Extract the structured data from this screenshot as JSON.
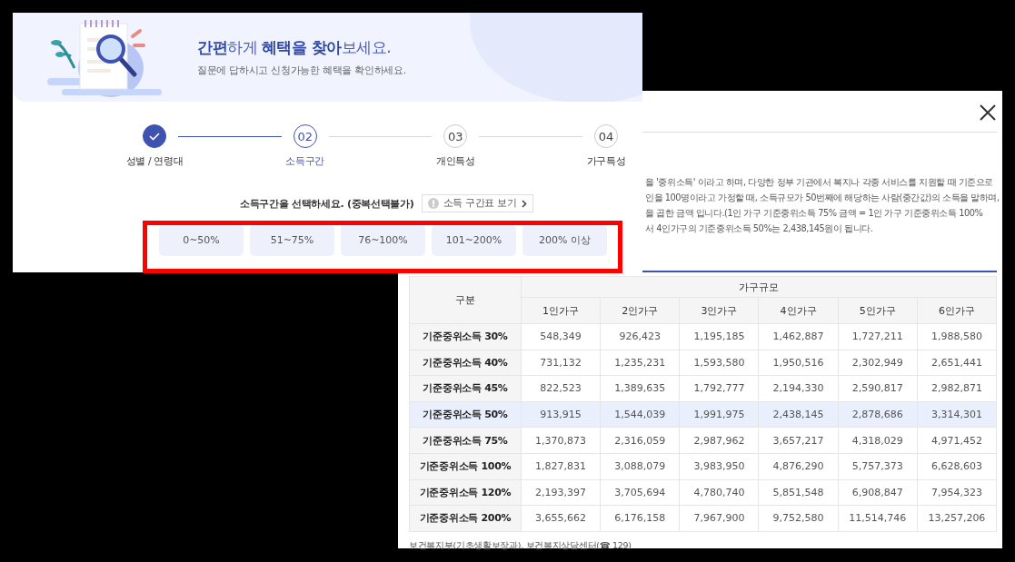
{
  "finder": {
    "title": "**간편**하게 **혜택을 찾아**보세요.",
    "subtitle": "질문에 답하시고 신청가능한 혜택을 확인하세요.",
    "steps": [
      {
        "label": "성별 / 연령대",
        "completed": true,
        "selected": false
      },
      {
        "number": "02",
        "label": "소득구간",
        "completed": false,
        "selected": true
      },
      {
        "number": "03",
        "label": "개인특성",
        "completed": false,
        "selected": false
      },
      {
        "number": "04",
        "label": "가구특성",
        "completed": false,
        "selected": false
      }
    ],
    "question": "소득구간을 선택하세요. (중복선택불가)",
    "table_button": "소득 구간표 보기",
    "options": [
      {
        "label": "0~50%",
        "selected": false
      },
      {
        "label": "51~75%",
        "selected": false
      },
      {
        "label": "76~100%",
        "selected": false
      },
      {
        "label": "101~200%",
        "selected": false
      },
      {
        "label": "200% 이상",
        "selected": false
      }
    ]
  },
  "dialog": {
    "description_lines": [
      "을 '중위소득' 이라고 하며, 다양한 정부 기관에서 복지나 각종 서비스를 지원할 때 기준으로",
      "인을 100명이라고 가정할 때, 소득규모가 50번째에 해당하는 사람(중간값)의 소득을 말하며,",
      "을 곱한 금액 입니다.(1인 가구 기준중위소득 75% 금액 = 1인 가구 기준중위소득 100%",
      "서 4인가구의 기준중위소득 50%는 2,438,145원이 됩니다."
    ],
    "table": {
      "row_header": "구분",
      "group_header": "가구규모",
      "columns": [
        "1인가구",
        "2인가구",
        "3인가구",
        "4인가구",
        "5인가구",
        "6인가구"
      ],
      "rows": [
        {
          "label": "기준중위소득 30%",
          "highlighted": false,
          "values": [
            "548,349",
            "926,423",
            "1,195,185",
            "1,462,887",
            "1,727,211",
            "1,988,580"
          ]
        },
        {
          "label": "기준중위소득 40%",
          "highlighted": false,
          "values": [
            "731,132",
            "1,235,231",
            "1,593,580",
            "1,950,516",
            "2,302,949",
            "2,651,441"
          ]
        },
        {
          "label": "기준중위소득 45%",
          "highlighted": false,
          "values": [
            "822,523",
            "1,389,635",
            "1,792,777",
            "2,194,330",
            "2,590,817",
            "2,982,871"
          ]
        },
        {
          "label": "기준중위소득 50%",
          "highlighted": true,
          "values": [
            "913,915",
            "1,544,039",
            "1,991,975",
            "2,438,145",
            "2,878,686",
            "3,314,301"
          ]
        },
        {
          "label": "기준중위소득 75%",
          "highlighted": false,
          "values": [
            "1,370,873",
            "2,316,059",
            "2,987,962",
            "3,657,217",
            "4,318,029",
            "4,971,452"
          ]
        },
        {
          "label": "기준중위소득 100%",
          "highlighted": false,
          "values": [
            "1,827,831",
            "3,088,079",
            "3,983,950",
            "4,876,290",
            "5,757,373",
            "6,628,603"
          ]
        },
        {
          "label": "기준중위소득 120%",
          "highlighted": false,
          "values": [
            "2,193,397",
            "3,705,694",
            "4,780,740",
            "5,851,548",
            "6,908,847",
            "7,954,323"
          ]
        },
        {
          "label": "기준중위소득 200%",
          "highlighted": false,
          "values": [
            "3,655,662",
            "6,176,158",
            "7,967,900",
            "9,752,580",
            "11,514,746",
            "13,257,206"
          ]
        }
      ]
    },
    "source": "보건복지부(기초생활보장과), 보건복지상담센터(☎ 129)"
  }
}
